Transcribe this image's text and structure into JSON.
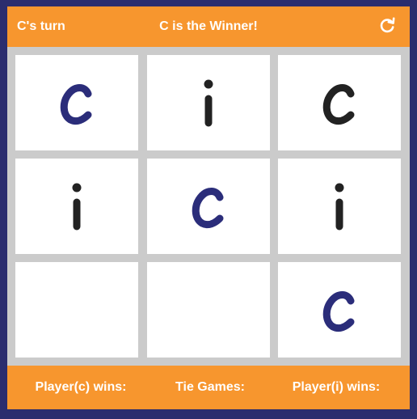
{
  "header": {
    "turn_text": "C's turn",
    "status_text": "C is the Winner!",
    "reset_icon": "refresh-icon"
  },
  "board": {
    "cells": [
      "c",
      "i",
      "c",
      "i",
      "c",
      "i",
      "",
      "",
      "c"
    ],
    "highlight_color": "#2b2d7a",
    "mark_color": "#222222",
    "winning_cells": [
      0,
      4,
      8
    ]
  },
  "footer": {
    "player_c_label": "Player(c) wins:",
    "tie_label": "Tie Games:",
    "player_i_label": "Player(i) wins:"
  },
  "colors": {
    "background": "#2b2d6e",
    "accent": "#f7962e",
    "grid": "#cbcbcb"
  }
}
